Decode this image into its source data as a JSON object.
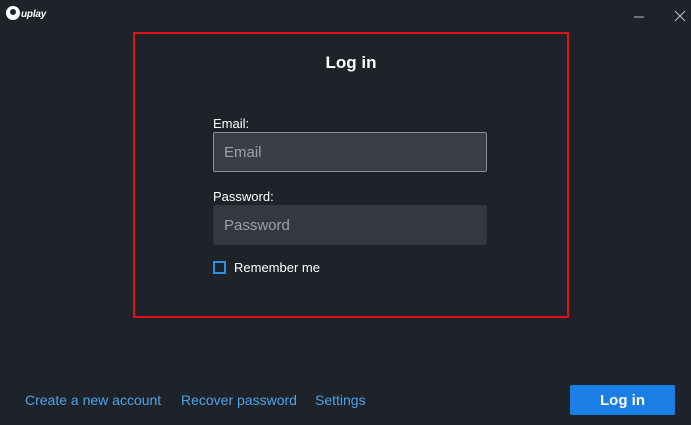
{
  "app": {
    "logo_text": "uplay"
  },
  "window_controls": {
    "minimize_icon": "minimize-icon",
    "close_icon": "close-icon"
  },
  "dialog": {
    "title": "Log in",
    "email": {
      "label": "Email:",
      "value": "",
      "placeholder": "Email"
    },
    "password": {
      "label": "Password:",
      "value": "",
      "placeholder": "Password"
    },
    "remember_me": {
      "label": "Remember me",
      "checked": false
    }
  },
  "footer": {
    "links": {
      "create": "Create a new account",
      "recover": "Recover password",
      "settings": "Settings"
    },
    "login_button": "Log in"
  },
  "colors": {
    "background": "#1e2229",
    "accent": "#1a7ee6",
    "link": "#4ba3ec",
    "highlight_border": "#e0101a"
  }
}
